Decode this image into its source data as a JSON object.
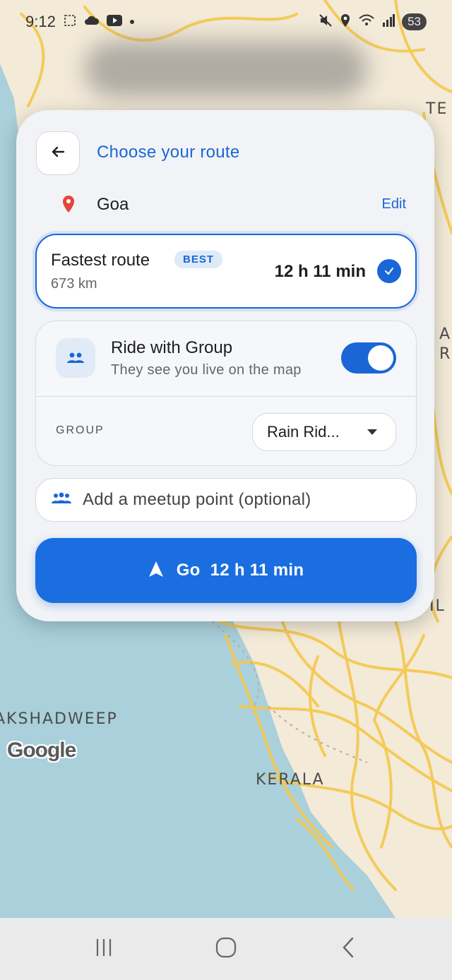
{
  "status_bar": {
    "time": "9:12",
    "battery": "53",
    "icons": [
      "screenshot-icon",
      "cloud-icon",
      "youtube-icon",
      "dot-icon",
      "mute-icon",
      "location-icon",
      "wifi-icon",
      "signal-icon"
    ]
  },
  "map": {
    "labels": {
      "lakshadweep": "AKSHADWEEP",
      "kerala": "KERALA",
      "te": "TE",
      "an": "AN\nR",
      "il": "IL"
    },
    "logo": "Google"
  },
  "route_panel": {
    "title": "Choose your route",
    "destination": "Goa",
    "edit_label": "Edit",
    "route": {
      "name": "Fastest route",
      "badge": "BEST",
      "distance": "673 km",
      "duration": "12 h 11 min",
      "selected": true
    },
    "group": {
      "title": "Ride with Group",
      "subtitle": "They see you live on the map",
      "enabled": true,
      "label": "GROUP",
      "selected": "Rain Rid..."
    },
    "meetup_placeholder": "Add a meetup point (optional)",
    "go_button": {
      "prefix": "Go",
      "duration": "12 h 11 min"
    }
  },
  "colors": {
    "accent": "#1a66d6",
    "sea": "#a9d0db",
    "land": "#f3ead8",
    "roads": "#f5c84c",
    "pin": "#e5453b"
  }
}
